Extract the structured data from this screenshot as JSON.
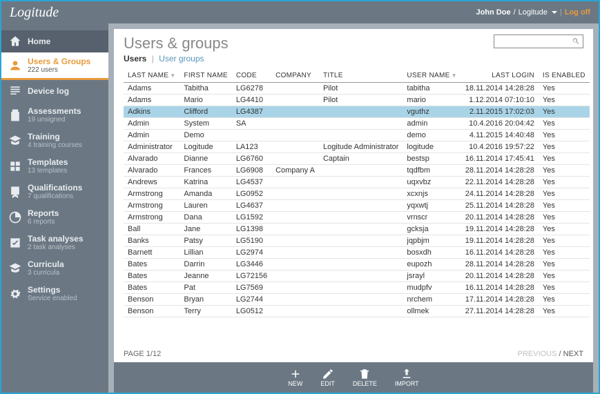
{
  "brand": "Logitude",
  "header": {
    "user": "John Doe",
    "org": "Logitude",
    "logoff": "Log off"
  },
  "sidebar": [
    {
      "id": "home",
      "label": "Home",
      "sub": ""
    },
    {
      "id": "users-groups",
      "label": "Users & Groups",
      "sub": "222 users"
    },
    {
      "id": "device-log",
      "label": "Device log",
      "sub": ""
    },
    {
      "id": "assessments",
      "label": "Assessments",
      "sub": "19 unsigned"
    },
    {
      "id": "training",
      "label": "Training",
      "sub": "4 training courses"
    },
    {
      "id": "templates",
      "label": "Templates",
      "sub": "13 templates"
    },
    {
      "id": "qualifications",
      "label": "Qualifications",
      "sub": "7 qualifications"
    },
    {
      "id": "reports",
      "label": "Reports",
      "sub": "6 reports"
    },
    {
      "id": "task-analyses",
      "label": "Task analyses",
      "sub": "2 task analyses"
    },
    {
      "id": "curricula",
      "label": "Curricula",
      "sub": "3 curricula"
    },
    {
      "id": "settings",
      "label": "Settings",
      "sub": "Service enabled"
    }
  ],
  "page": {
    "title": "Users & groups",
    "tabs": [
      "Users",
      "User groups"
    ],
    "active_tab": 0,
    "search_placeholder": ""
  },
  "columns": [
    "LAST NAME",
    "FIRST NAME",
    "CODE",
    "COMPANY",
    "TITLE",
    "USER NAME",
    "LAST LOGIN",
    "IS ENABLED"
  ],
  "rows": [
    {
      "last": "Adams",
      "first": "Tabitha",
      "code": "LG6278",
      "company": "",
      "title": "Pilot",
      "user": "tabitha",
      "login": "18.11.2014 14:28:28",
      "enabled": "Yes"
    },
    {
      "last": "Adams",
      "first": "Mario",
      "code": "LG4410",
      "company": "",
      "title": "Pilot",
      "user": "mario",
      "login": "1.12.2014 07:10:10",
      "enabled": "Yes"
    },
    {
      "last": "Adkins",
      "first": "Clifford",
      "code": "LG4387",
      "company": "",
      "title": "",
      "user": "vguthz",
      "login": "2.11.2015 17:02:03",
      "enabled": "Yes",
      "selected": true
    },
    {
      "last": "Admin",
      "first": "System",
      "code": "SA",
      "company": "",
      "title": "",
      "user": "admin",
      "login": "10.4.2016 20:04:42",
      "enabled": "Yes"
    },
    {
      "last": "Admin",
      "first": "Demo",
      "code": "",
      "company": "",
      "title": "",
      "user": "demo",
      "login": "4.11.2015 14:40:48",
      "enabled": "Yes"
    },
    {
      "last": "Administrator",
      "first": "Logitude",
      "code": "LA123",
      "company": "",
      "title": "Logitude Administrator",
      "user": "logitude",
      "login": "10.4.2016 19:57:22",
      "enabled": "Yes"
    },
    {
      "last": "Alvarado",
      "first": "Dianne",
      "code": "LG6760",
      "company": "",
      "title": "Captain",
      "user": "bestsp",
      "login": "16.11.2014 17:45:41",
      "enabled": "Yes"
    },
    {
      "last": "Alvarado",
      "first": "Frances",
      "code": "LG6908",
      "company": "Company A",
      "title": "",
      "user": "tqdfbm",
      "login": "28.11.2014 14:28:28",
      "enabled": "Yes"
    },
    {
      "last": "Andrews",
      "first": "Katrina",
      "code": "LG4537",
      "company": "",
      "title": "",
      "user": "uqxvbz",
      "login": "22.11.2014 14:28:28",
      "enabled": "Yes"
    },
    {
      "last": "Armstrong",
      "first": "Amanda",
      "code": "LG0952",
      "company": "",
      "title": "",
      "user": "xcxnjs",
      "login": "24.11.2014 14:28:28",
      "enabled": "Yes"
    },
    {
      "last": "Armstrong",
      "first": "Lauren",
      "code": "LG4637",
      "company": "",
      "title": "",
      "user": "yqxwtj",
      "login": "25.11.2014 14:28:28",
      "enabled": "Yes"
    },
    {
      "last": "Armstrong",
      "first": "Dana",
      "code": "LG1592",
      "company": "",
      "title": "",
      "user": "vrnscr",
      "login": "20.11.2014 14:28:28",
      "enabled": "Yes"
    },
    {
      "last": "Ball",
      "first": "Jane",
      "code": "LG1398",
      "company": "",
      "title": "",
      "user": "gcksja",
      "login": "19.11.2014 14:28:28",
      "enabled": "Yes"
    },
    {
      "last": "Banks",
      "first": "Patsy",
      "code": "LG5190",
      "company": "",
      "title": "",
      "user": "jqpbjm",
      "login": "19.11.2014 14:28:28",
      "enabled": "Yes"
    },
    {
      "last": "Barnett",
      "first": "Lillian",
      "code": "LG2974",
      "company": "",
      "title": "",
      "user": "bosxdh",
      "login": "16.11.2014 14:28:28",
      "enabled": "Yes"
    },
    {
      "last": "Bates",
      "first": "Darrin",
      "code": "LG3446",
      "company": "",
      "title": "",
      "user": "eupozh",
      "login": "28.11.2014 14:28:28",
      "enabled": "Yes"
    },
    {
      "last": "Bates",
      "first": "Jeanne",
      "code": "LG72156",
      "company": "",
      "title": "",
      "user": "jsrayl",
      "login": "20.11.2014 14:28:28",
      "enabled": "Yes"
    },
    {
      "last": "Bates",
      "first": "Pat",
      "code": "LG7569",
      "company": "",
      "title": "",
      "user": "mudpfv",
      "login": "16.11.2014 14:28:28",
      "enabled": "Yes"
    },
    {
      "last": "Benson",
      "first": "Bryan",
      "code": "LG2744",
      "company": "",
      "title": "",
      "user": "nrchem",
      "login": "17.11.2014 14:28:28",
      "enabled": "Yes"
    },
    {
      "last": "Benson",
      "first": "Terry",
      "code": "LG0512",
      "company": "",
      "title": "",
      "user": "ollmek",
      "login": "27.11.2014 14:28:28",
      "enabled": "Yes"
    }
  ],
  "pager": {
    "label": "PAGE 1/12",
    "prev": "PREVIOUS",
    "next": "NEXT"
  },
  "footer": [
    {
      "id": "new",
      "label": "NEW"
    },
    {
      "id": "edit",
      "label": "EDIT"
    },
    {
      "id": "delete",
      "label": "DELETE"
    },
    {
      "id": "import",
      "label": "IMPORT"
    }
  ]
}
